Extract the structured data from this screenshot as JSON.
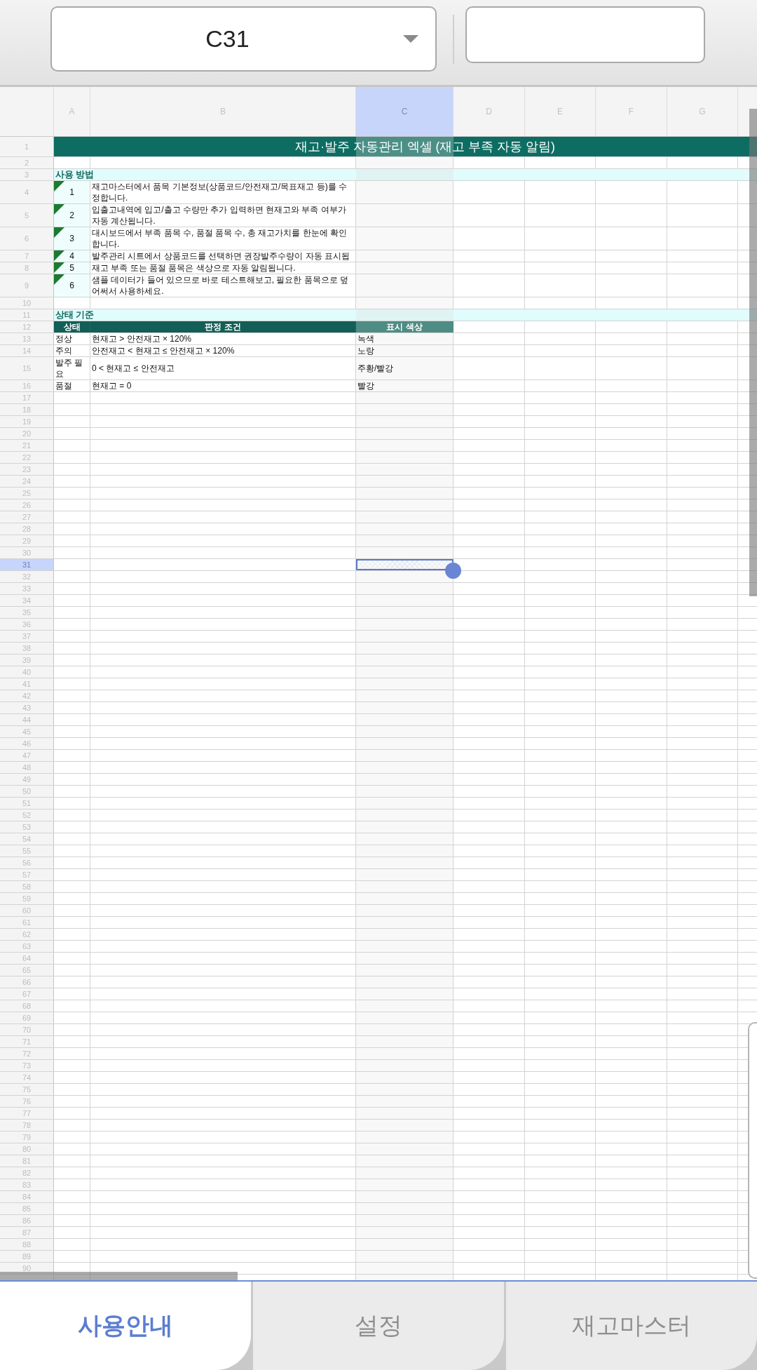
{
  "toolbar": {
    "cell_reference": "C31"
  },
  "sheet": {
    "columns": [
      {
        "label": "A",
        "selected": false
      },
      {
        "label": "B",
        "selected": false
      },
      {
        "label": "C",
        "selected": true
      },
      {
        "label": "D",
        "selected": false
      },
      {
        "label": "E",
        "selected": false
      },
      {
        "label": "F",
        "selected": false
      },
      {
        "label": "G",
        "selected": false
      }
    ],
    "row_headers": [
      {
        "label": "1",
        "selected": false
      },
      {
        "label": "2",
        "selected": false
      },
      {
        "label": "3",
        "selected": false
      },
      {
        "label": "4",
        "selected": false
      },
      {
        "label": "5",
        "selected": false
      },
      {
        "label": "6",
        "selected": false
      },
      {
        "label": "7",
        "selected": false
      },
      {
        "label": "8",
        "selected": false
      },
      {
        "label": "9",
        "selected": false
      },
      {
        "label": "10",
        "selected": false
      },
      {
        "label": "11",
        "selected": false
      },
      {
        "label": "12",
        "selected": false
      },
      {
        "label": "13",
        "selected": false
      },
      {
        "label": "14",
        "selected": false
      },
      {
        "label": "15",
        "selected": false
      },
      {
        "label": "16",
        "selected": false
      },
      {
        "label": "17",
        "selected": false
      },
      {
        "label": "18",
        "selected": false
      },
      {
        "label": "19",
        "selected": false
      },
      {
        "label": "20",
        "selected": false
      },
      {
        "label": "21",
        "selected": false
      },
      {
        "label": "22",
        "selected": false
      },
      {
        "label": "23",
        "selected": false
      },
      {
        "label": "24",
        "selected": false
      },
      {
        "label": "25",
        "selected": false
      },
      {
        "label": "26",
        "selected": false
      },
      {
        "label": "27",
        "selected": false
      },
      {
        "label": "28",
        "selected": false
      },
      {
        "label": "29",
        "selected": false
      },
      {
        "label": "30",
        "selected": false
      },
      {
        "label": "31",
        "selected": true
      },
      {
        "label": "32",
        "selected": false
      },
      {
        "label": "33",
        "selected": false
      },
      {
        "label": "34",
        "selected": false
      },
      {
        "label": "35",
        "selected": false
      },
      {
        "label": "36",
        "selected": false
      },
      {
        "label": "37",
        "selected": false
      },
      {
        "label": "38",
        "selected": false
      },
      {
        "label": "39",
        "selected": false
      },
      {
        "label": "40",
        "selected": false
      },
      {
        "label": "41",
        "selected": false
      },
      {
        "label": "42",
        "selected": false
      },
      {
        "label": "43",
        "selected": false
      },
      {
        "label": "44",
        "selected": false
      },
      {
        "label": "45",
        "selected": false
      },
      {
        "label": "46",
        "selected": false
      },
      {
        "label": "47",
        "selected": false
      },
      {
        "label": "48",
        "selected": false
      },
      {
        "label": "49",
        "selected": false
      },
      {
        "label": "50",
        "selected": false
      },
      {
        "label": "51",
        "selected": false
      },
      {
        "label": "52",
        "selected": false
      },
      {
        "label": "53",
        "selected": false
      },
      {
        "label": "54",
        "selected": false
      },
      {
        "label": "55",
        "selected": false
      },
      {
        "label": "56",
        "selected": false
      },
      {
        "label": "57",
        "selected": false
      },
      {
        "label": "58",
        "selected": false
      },
      {
        "label": "59",
        "selected": false
      },
      {
        "label": "60",
        "selected": false
      },
      {
        "label": "61",
        "selected": false
      },
      {
        "label": "62",
        "selected": false
      },
      {
        "label": "63",
        "selected": false
      },
      {
        "label": "64",
        "selected": false
      },
      {
        "label": "65",
        "selected": false
      },
      {
        "label": "66",
        "selected": false
      },
      {
        "label": "67",
        "selected": false
      },
      {
        "label": "68",
        "selected": false
      },
      {
        "label": "69",
        "selected": false
      },
      {
        "label": "70",
        "selected": false
      },
      {
        "label": "71",
        "selected": false
      },
      {
        "label": "72",
        "selected": false
      },
      {
        "label": "73",
        "selected": false
      },
      {
        "label": "74",
        "selected": false
      },
      {
        "label": "75",
        "selected": false
      },
      {
        "label": "76",
        "selected": false
      },
      {
        "label": "77",
        "selected": false
      },
      {
        "label": "78",
        "selected": false
      },
      {
        "label": "79",
        "selected": false
      },
      {
        "label": "80",
        "selected": false
      },
      {
        "label": "81",
        "selected": false
      },
      {
        "label": "82",
        "selected": false
      },
      {
        "label": "83",
        "selected": false
      },
      {
        "label": "84",
        "selected": false
      },
      {
        "label": "85",
        "selected": false
      },
      {
        "label": "86",
        "selected": false
      },
      {
        "label": "87",
        "selected": false
      },
      {
        "label": "88",
        "selected": false
      },
      {
        "label": "89",
        "selected": false
      },
      {
        "label": "90",
        "selected": false
      }
    ],
    "title": "재고·발주 자동관리 엑셀 (재고 부족 자동 알림)",
    "usage": {
      "heading": "사용 방법",
      "steps": [
        {
          "number": "1",
          "text": "재고마스터에서 품목 기본정보(상품코드/안전재고/목표재고 등)를 수정합니다."
        },
        {
          "number": "2",
          "text": "입출고내역에 입고/출고 수량만 추가 입력하면 현재고와 부족 여부가 자동 계산됩니다."
        },
        {
          "number": "3",
          "text": "대시보드에서 부족 품목 수, 품절 품목 수, 총 재고가치를 한눈에 확인합니다."
        },
        {
          "number": "4",
          "text": "발주관리 시트에서 상품코드를 선택하면 권장발주수량이 자동 표시됩"
        },
        {
          "number": "5",
          "text": "재고 부족 또는 품절 품목은 색상으로 자동 알림됩니다."
        },
        {
          "number": "6",
          "text": "샘플 데이터가 들어 있으므로 바로 테스트해보고, 필요한 품목으로 덮어써서 사용하세요."
        }
      ]
    },
    "status": {
      "heading": "상태 기준",
      "columns": [
        "상태",
        "판정 조건",
        "표시 색상"
      ],
      "rows": [
        {
          "status": "정상",
          "condition": "현재고 > 안전재고 × 120%",
          "color_name": "녹색"
        },
        {
          "status": "주의",
          "condition": "안전재고 < 현재고 ≤ 안전재고 × 120%",
          "color_name": "노랑"
        },
        {
          "status": "발주 필요",
          "condition": "0 < 현재고 ≤ 안전재고",
          "color_name": "주황/빨강"
        },
        {
          "status": "품절",
          "condition": "현재고 = 0",
          "color_name": "빨강"
        }
      ]
    }
  },
  "tabs": [
    {
      "label": "사용안내",
      "selected": true
    },
    {
      "label": "설정",
      "selected": false
    },
    {
      "label": "재고마스터",
      "selected": false
    }
  ]
}
